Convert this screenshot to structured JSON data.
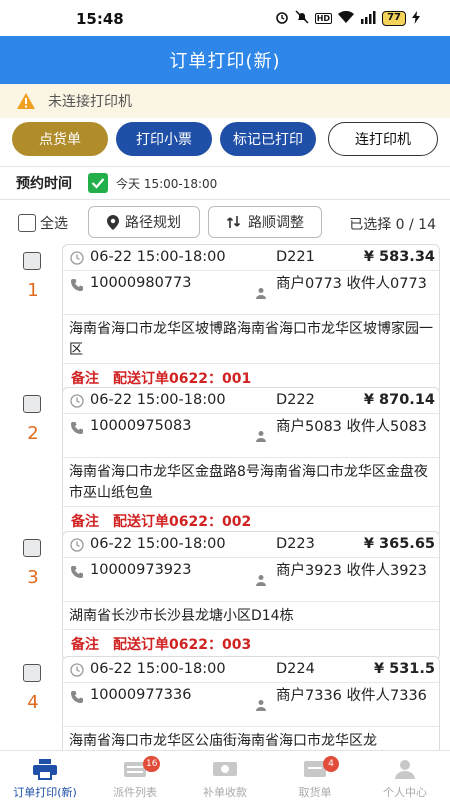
{
  "status_bar": {
    "time": "15:48",
    "battery": "77"
  },
  "header": {
    "title": "订单打印(新)"
  },
  "warning": {
    "text": "未连接打印机"
  },
  "actions": {
    "count_goods": "点货单",
    "print_ticket": "打印小票",
    "mark_printed": "标记已打印",
    "connect_printer": "连打印机"
  },
  "schedule": {
    "label": "预约时间",
    "value": "今天 15:00-18:00",
    "checked": true
  },
  "toolbar": {
    "select_all": "全选",
    "route_plan": "路径规划",
    "route_adjust": "路顺调整",
    "selected_count": "已选择 0 / 14"
  },
  "orders": [
    {
      "index": "1",
      "time": "06-22 15:00-18:00",
      "code": "D221",
      "amount": "¥ 583.34",
      "phone": "10000980773",
      "merchant": "商户0773 收件人0773",
      "address": "海南省海口市龙华区坡博路海南省海口市龙华区坡博家园一区",
      "remark_label": "备注",
      "remark": "配送订单0622：001"
    },
    {
      "index": "2",
      "time": "06-22 15:00-18:00",
      "code": "D222",
      "amount": "¥ 870.14",
      "phone": "10000975083",
      "merchant": "商户5083 收件人5083",
      "address": "海南省海口市龙华区金盘路8号海南省海口市龙华区金盘夜市巫山纸包鱼",
      "remark_label": "备注",
      "remark": "配送订单0622：002"
    },
    {
      "index": "3",
      "time": "06-22 15:00-18:00",
      "code": "D223",
      "amount": "¥ 365.65",
      "phone": "10000973923",
      "merchant": "商户3923 收件人3923",
      "address": "湖南省长沙市长沙县龙塘小区D14栋",
      "remark_label": "备注",
      "remark": "配送订单0622：003"
    },
    {
      "index": "4",
      "time": "06-22 15:00-18:00",
      "code": "D224",
      "amount": "¥ 531.5",
      "phone": "10000977336",
      "merchant": "商户7336 收件人7336",
      "address": "海南省海口市龙华区公庙街海南省海口市龙华区龙",
      "remark_label": "",
      "remark": ""
    }
  ],
  "tabs": [
    {
      "label": "订单打印(新)",
      "icon": "printer-icon",
      "active": true
    },
    {
      "label": "派件列表",
      "icon": "list-icon",
      "badge": "16"
    },
    {
      "label": "补单收款",
      "icon": "money-icon"
    },
    {
      "label": "取货单",
      "icon": "ticket-icon",
      "badge": "4"
    },
    {
      "label": "个人中心",
      "icon": "user-icon"
    }
  ],
  "colors": {
    "primary": "#2d86e8",
    "button_blue": "#1f4fa6",
    "button_gold": "#b08c2a",
    "index_orange": "#e06a1b",
    "remark_red": "#d12222",
    "check_green": "#23b04a"
  }
}
